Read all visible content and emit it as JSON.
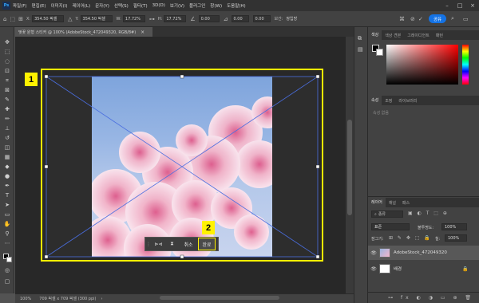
{
  "menu": [
    "파일(F)",
    "편집(E)",
    "이미지(I)",
    "레이어(L)",
    "문자(Y)",
    "선택(S)",
    "필터(T)",
    "3D(D)",
    "보기(V)",
    "플러그인",
    "창(W)",
    "도움말(H)"
  ],
  "options_bar": {
    "x_label": "X:",
    "x_value": "354.50 픽셀",
    "y_label": "Y:",
    "y_value": "354.50 픽셀",
    "w_label": "W:",
    "w_value": "17.72%",
    "h_label": "H:",
    "h_value": "17.72%",
    "angle_value": "0.00",
    "h_skew": "0.00",
    "v_skew": "0.00",
    "interp_label": "보간:",
    "interp_value": "쌍입방",
    "share_label": "공유"
  },
  "document": {
    "tab_title": "벚꽃 원형 스티커 @ 100% (AdobeStock_472049320, RGB/8#)",
    "close": "×",
    "status_zoom": "100%",
    "status_info": "709 픽셀 x 709 픽셀 (300 ppi)"
  },
  "transform_bar": {
    "cancel_label": "취소",
    "commit_label": "완료"
  },
  "markers": [
    "1",
    "2"
  ],
  "color_panel": {
    "tabs": [
      "색상",
      "색상 견본",
      "그레이디언트",
      "패턴"
    ]
  },
  "properties_panel": {
    "tabs": [
      "속성",
      "조정",
      "라이브러리"
    ],
    "empty_text": "속성 없음"
  },
  "layers_panel": {
    "tabs": [
      "레이어",
      "채널",
      "패스"
    ],
    "search_placeholder": "종류",
    "blend_mode": "표준",
    "opacity_label": "불투명도:",
    "opacity_value": "100%",
    "lock_label": "잠그기:",
    "fill_label": "칠:",
    "fill_value": "100%",
    "layers": [
      {
        "name": "AdobeStock_472049320",
        "selected": true
      },
      {
        "name": "배경",
        "locked": true
      }
    ]
  },
  "colors": {
    "marker_yellow": "#fff200",
    "accent_blue": "#1473e6",
    "transform_line": "#4a6ee0"
  }
}
